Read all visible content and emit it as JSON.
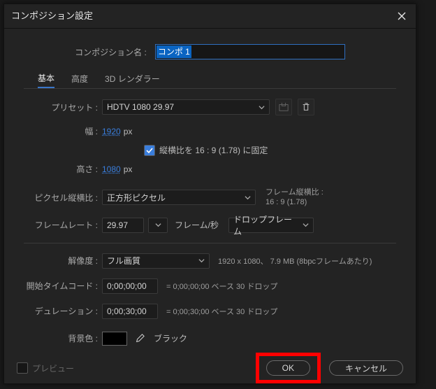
{
  "dialog": {
    "title": "コンポジション設定",
    "compname_label": "コンポジション名 :",
    "compname_value": "コンポ 1"
  },
  "tabs": {
    "basic": "基本",
    "advanced": "高度",
    "renderer": "3D レンダラー"
  },
  "preset": {
    "label": "プリセット :",
    "value": "HDTV 1080 29.97"
  },
  "size": {
    "width_label": "幅 :",
    "width_value": "1920",
    "height_label": "高さ :",
    "height_value": "1080",
    "px": "px",
    "lock_label": "縦横比を 16 : 9 (1.78) に固定"
  },
  "par": {
    "label": "ピクセル縦横比 :",
    "value": "正方形ピクセル",
    "frame_aspect_label": "フレーム縦横比 :",
    "frame_aspect_value": "16 : 9 (1.78)"
  },
  "framerate": {
    "label": "フレームレート :",
    "value": "29.97",
    "unit": "フレーム/秒",
    "drop": "ドロップフレーム"
  },
  "resolution": {
    "label": "解像度 :",
    "value": "フル画質",
    "info": "1920 x 1080、 7.9 MB (8bpcフレームあたり)"
  },
  "start": {
    "label": "開始タイムコード :",
    "value": "0;00;00;00",
    "info": "= 0;00;00;00  ベース 30  ドロップ"
  },
  "duration": {
    "label": "デュレーション :",
    "value": "0;00;30;00",
    "info": "= 0;00;30;00  ベース 30  ドロップ"
  },
  "bg": {
    "label": "背景色 :",
    "name": "ブラック",
    "hex": "#000000"
  },
  "footer": {
    "preview": "プレビュー",
    "ok": "OK",
    "cancel": "キャンセル"
  }
}
